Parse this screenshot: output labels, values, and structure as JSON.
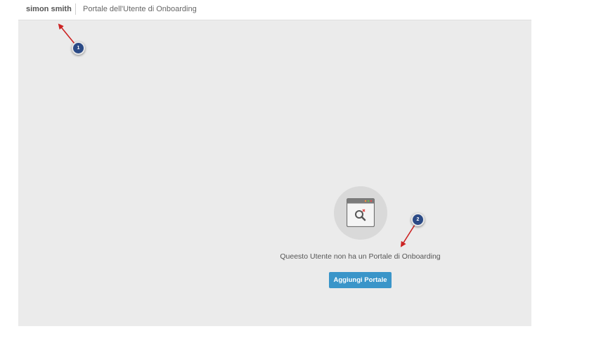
{
  "header": {
    "user_name": "simon smith",
    "portal_title": "Portale dell'Utente di Onboarding"
  },
  "empty_state": {
    "icon": "window-search-icon",
    "message": "Queesto Utente non ha un Portale di Onboarding",
    "button_label": "Aggiungi Portale"
  },
  "annotations": {
    "marker_1": "1",
    "marker_2": "2"
  },
  "colors": {
    "panel_background": "#ebebeb",
    "button": "#3a95c9",
    "marker": "#2b4a86",
    "arrow": "#cc2222"
  }
}
